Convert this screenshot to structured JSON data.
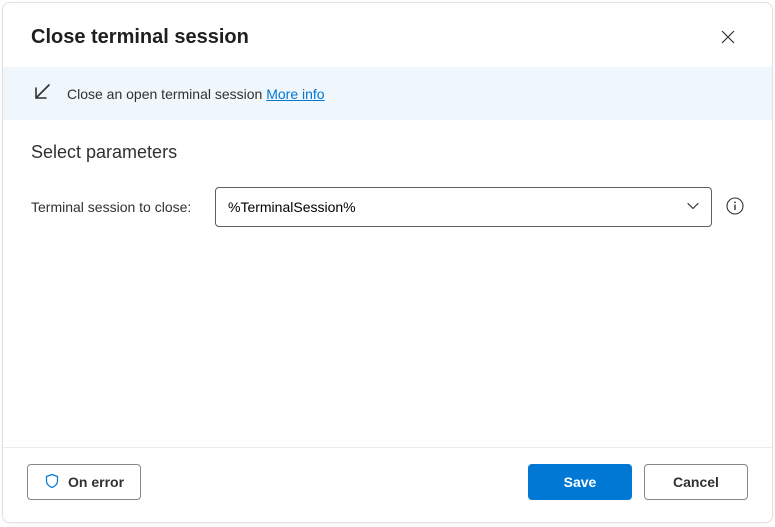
{
  "header": {
    "title": "Close terminal session"
  },
  "banner": {
    "description": "Close an open terminal session",
    "more_info_label": "More info"
  },
  "content": {
    "section_heading": "Select parameters",
    "param_label": "Terminal session to close:",
    "param_value": "%TerminalSession%"
  },
  "footer": {
    "on_error_label": "On error",
    "save_label": "Save",
    "cancel_label": "Cancel"
  }
}
